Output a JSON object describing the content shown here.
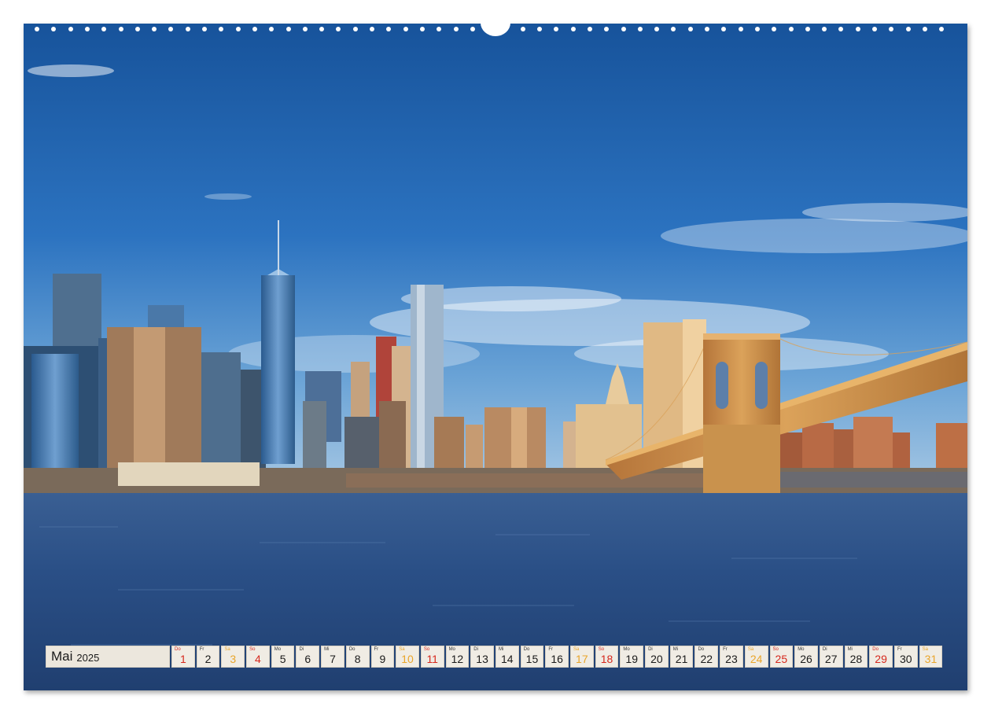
{
  "calendar": {
    "month": "Mai",
    "year": "2025",
    "days": [
      {
        "d": "Do",
        "n": "1",
        "kind": "sun"
      },
      {
        "d": "Fr",
        "n": "2",
        "kind": "work"
      },
      {
        "d": "Sa",
        "n": "3",
        "kind": "sat"
      },
      {
        "d": "So",
        "n": "4",
        "kind": "sun"
      },
      {
        "d": "Mo",
        "n": "5",
        "kind": "work"
      },
      {
        "d": "Di",
        "n": "6",
        "kind": "work"
      },
      {
        "d": "Mi",
        "n": "7",
        "kind": "work"
      },
      {
        "d": "Do",
        "n": "8",
        "kind": "work"
      },
      {
        "d": "Fr",
        "n": "9",
        "kind": "work"
      },
      {
        "d": "Sa",
        "n": "10",
        "kind": "sat"
      },
      {
        "d": "So",
        "n": "11",
        "kind": "sun"
      },
      {
        "d": "Mo",
        "n": "12",
        "kind": "work"
      },
      {
        "d": "Di",
        "n": "13",
        "kind": "work"
      },
      {
        "d": "Mi",
        "n": "14",
        "kind": "work"
      },
      {
        "d": "Do",
        "n": "15",
        "kind": "work"
      },
      {
        "d": "Fr",
        "n": "16",
        "kind": "work"
      },
      {
        "d": "Sa",
        "n": "17",
        "kind": "sat"
      },
      {
        "d": "So",
        "n": "18",
        "kind": "sun"
      },
      {
        "d": "Mo",
        "n": "19",
        "kind": "work"
      },
      {
        "d": "Di",
        "n": "20",
        "kind": "work"
      },
      {
        "d": "Mi",
        "n": "21",
        "kind": "work"
      },
      {
        "d": "Do",
        "n": "22",
        "kind": "work"
      },
      {
        "d": "Fr",
        "n": "23",
        "kind": "work"
      },
      {
        "d": "Sa",
        "n": "24",
        "kind": "sat"
      },
      {
        "d": "So",
        "n": "25",
        "kind": "sun"
      },
      {
        "d": "Mo",
        "n": "26",
        "kind": "work"
      },
      {
        "d": "Di",
        "n": "27",
        "kind": "work"
      },
      {
        "d": "Mi",
        "n": "28",
        "kind": "work"
      },
      {
        "d": "Do",
        "n": "29",
        "kind": "sun"
      },
      {
        "d": "Fr",
        "n": "30",
        "kind": "work"
      },
      {
        "d": "Sa",
        "n": "31",
        "kind": "sat"
      }
    ]
  },
  "colors": {
    "sky_top": "#1c5ea8",
    "sky_mid": "#2f78c4",
    "water": "#2a4f86",
    "sunday_red": "#d6281d",
    "saturday_orange": "#e9a52a",
    "bridge": "#c98a3c"
  }
}
